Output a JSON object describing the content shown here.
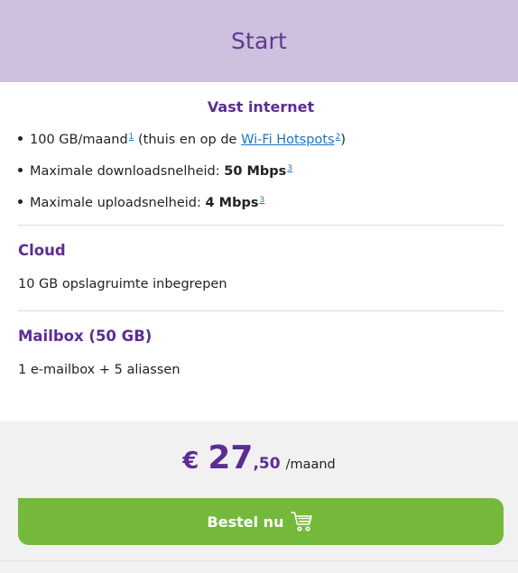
{
  "header": {
    "title": "Start"
  },
  "internet": {
    "title": "Vast internet",
    "data_prefix": "100 GB/maand",
    "data_sup": "1",
    "data_mid": " (thuis en op de ",
    "hotspots_link": "Wi-Fi Hotspots",
    "hotspots_sup": "2",
    "data_suffix": ")",
    "download_label": "Maximale downloadsnelheid: ",
    "download_value": "50 Mbps",
    "download_sup": "3",
    "upload_label": "Maximale uploadsnelheid: ",
    "upload_value": "4 Mbps",
    "upload_sup": "3"
  },
  "cloud": {
    "title": "Cloud",
    "text": "10 GB opslagruimte inbegrepen"
  },
  "mailbox": {
    "title": "Mailbox (50 GB)",
    "text": "1 e-mailbox + 5 aliassen"
  },
  "price": {
    "currency": "€",
    "whole": "27",
    "decimal": ",50",
    "period": "/maand"
  },
  "cta": {
    "label": "Bestel nu",
    "icon": "cart-icon"
  },
  "colors": {
    "accent": "#5c2d91",
    "header_bg": "#cfc0e0",
    "button": "#74b93b",
    "link": "#1a73c8"
  }
}
